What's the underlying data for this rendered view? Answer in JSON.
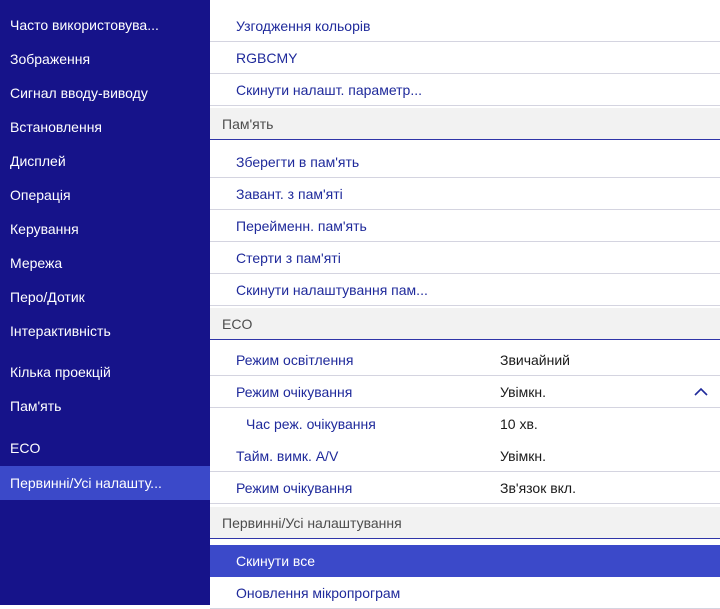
{
  "sidebar": {
    "items": [
      {
        "label": "Часто використовува..."
      },
      {
        "label": "Зображення"
      },
      {
        "label": "Сигнал вводу-виводу"
      },
      {
        "label": "Встановлення"
      },
      {
        "label": "Дисплей"
      },
      {
        "label": "Операція"
      },
      {
        "label": "Керування"
      },
      {
        "label": "Мережа"
      },
      {
        "label": "Перо/Дотик"
      },
      {
        "label": "Інтерактивність"
      },
      {
        "label": "Кілька проекцій"
      },
      {
        "label": "Пам'ять"
      },
      {
        "label": "ECO"
      },
      {
        "label": "Первинні/Усі налашту..."
      }
    ],
    "active_index": 13
  },
  "panel": {
    "top_items": [
      {
        "label": "Узгодження кольорів"
      },
      {
        "label": "RGBCMY"
      },
      {
        "label": "Скинути налашт. параметр..."
      }
    ],
    "memory": {
      "header": "Пам'ять",
      "items": [
        {
          "label": "Зберегти в пам'ять"
        },
        {
          "label": "Завант. з пам'яті"
        },
        {
          "label": "Перейменн. пам'ять"
        },
        {
          "label": "Стерти з пам'яті"
        },
        {
          "label": "Скинути налаштування пам..."
        }
      ]
    },
    "eco": {
      "header": "ECO",
      "items": [
        {
          "label": "Режим освітлення",
          "value": "Звичайний"
        },
        {
          "label": "Режим очікування",
          "value": "Увімкн."
        },
        {
          "label": "Час реж. очікування",
          "value": "10 хв."
        },
        {
          "label": "Тайм. вимк. A/V",
          "value": "Увімкн."
        },
        {
          "label": "Режим очікування",
          "value": "Зв'язок вкл."
        }
      ]
    },
    "initial": {
      "header": "Первинні/Усі налаштування",
      "items": [
        {
          "label": "Скинути все"
        },
        {
          "label": "Оновлення мікропрограм"
        }
      ]
    }
  },
  "icons": {
    "collapse": "chevron-up-icon"
  },
  "colors": {
    "sidebar_bg": "#16138a",
    "highlight": "#3b49c9",
    "item_text": "#1f2a9b"
  }
}
